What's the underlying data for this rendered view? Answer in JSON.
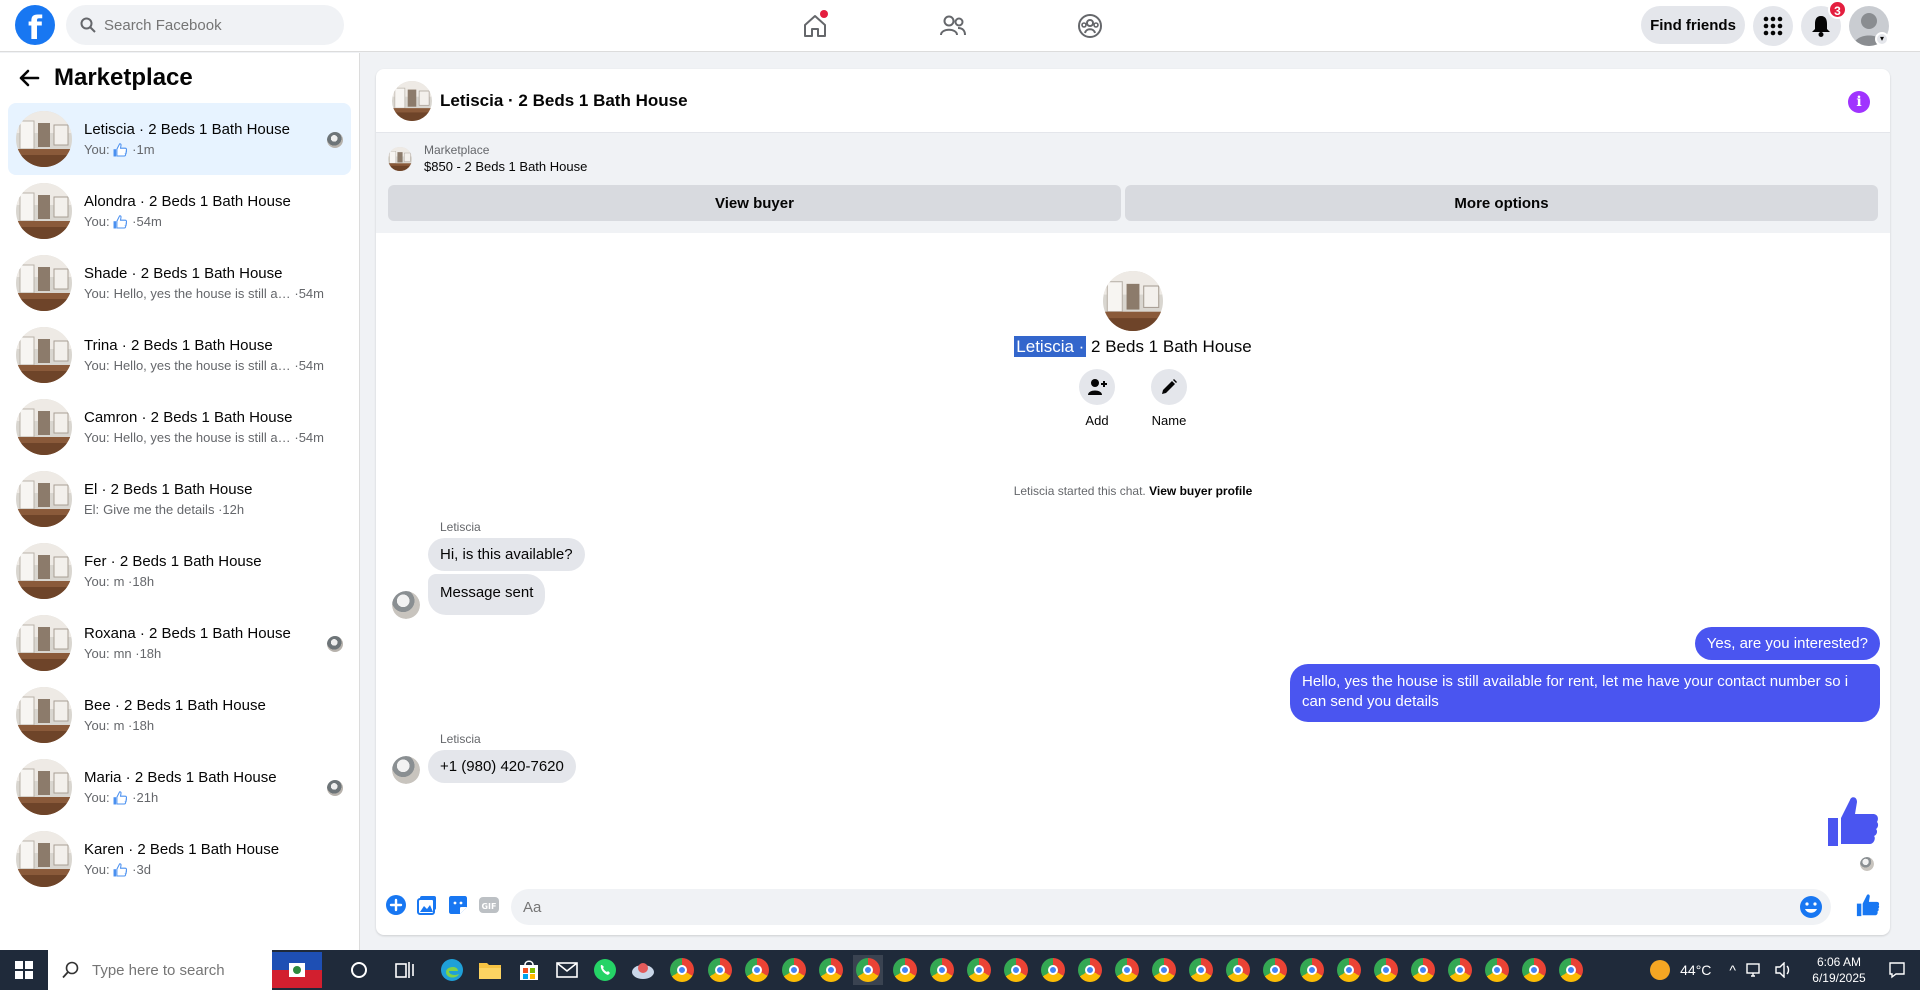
{
  "topnav": {
    "search_placeholder": "Search Facebook",
    "find_friends": "Find friends",
    "notifications_count": "3"
  },
  "sidebar": {
    "title": "Marketplace",
    "conversations": [
      {
        "name": "Letiscia · 2 Beds 1 Bath House",
        "prefix": "You:",
        "preview": "",
        "like": true,
        "time": "1m",
        "active": true,
        "seen": true
      },
      {
        "name": "Alondra · 2 Beds 1 Bath House",
        "prefix": "You:",
        "preview": "",
        "like": true,
        "time": "54m"
      },
      {
        "name": "Shade · 2 Beds 1 Bath House",
        "prefix": "You:",
        "preview": "Hello, yes the house is still avail...",
        "like": false,
        "time": "54m"
      },
      {
        "name": "Trina · 2 Beds 1 Bath House",
        "prefix": "You:",
        "preview": "Hello, yes the house is still avail...",
        "like": false,
        "time": "54m"
      },
      {
        "name": "Camron · 2 Beds 1 Bath House",
        "prefix": "You:",
        "preview": "Hello, yes the house is still avail...",
        "like": false,
        "time": "54m"
      },
      {
        "name": "El · 2 Beds 1 Bath House",
        "prefix": "El:",
        "preview": "Give me the details",
        "like": false,
        "time": "12h"
      },
      {
        "name": "Fer · 2 Beds 1 Bath House",
        "prefix": "You:",
        "preview": "m",
        "like": false,
        "time": "18h"
      },
      {
        "name": "Roxana · 2 Beds 1 Bath House",
        "prefix": "You:",
        "preview": "mn",
        "like": false,
        "time": "18h",
        "seen": true
      },
      {
        "name": "Bee · 2 Beds 1 Bath House",
        "prefix": "You:",
        "preview": "m",
        "like": false,
        "time": "18h"
      },
      {
        "name": "Maria · 2 Beds 1 Bath House",
        "prefix": "You:",
        "preview": "",
        "like": true,
        "time": "21h",
        "seen": true
      },
      {
        "name": "Karen · 2 Beds 1 Bath House",
        "prefix": "You:",
        "preview": "",
        "like": true,
        "time": "3d"
      }
    ]
  },
  "chat": {
    "title": "Letiscia · 2 Beds 1 Bath House",
    "marketplace_label": "Marketplace",
    "listing": "$850 - 2 Beds 1 Bath House",
    "view_buyer": "View buyer",
    "more_options": "More options",
    "profile_name_hl": "Letiscia ·",
    "profile_name_rest": " 2 Beds 1 Bath House",
    "add_label": "Add",
    "name_label": "Name",
    "started_text": "Letiscia started this chat.",
    "view_buyer_profile": "View buyer profile",
    "sender": "Letiscia",
    "messages": {
      "in1": "Hi, is this available?",
      "in2": "Message sent",
      "out1": "Yes, are you interested?",
      "out2": "Hello, yes the house is still available for rent, let me have your contact number so i can send you details",
      "in3": "+1 (980) 420-7620"
    },
    "composer_placeholder": "Aa"
  },
  "taskbar": {
    "search_placeholder": "Type here to search",
    "temperature": "44°C",
    "time": "6:06 AM",
    "date": "6/19/2025"
  },
  "colors": {
    "brand": "#1877f2",
    "outgoing": "#4a55f0",
    "info": "#a033ff"
  }
}
